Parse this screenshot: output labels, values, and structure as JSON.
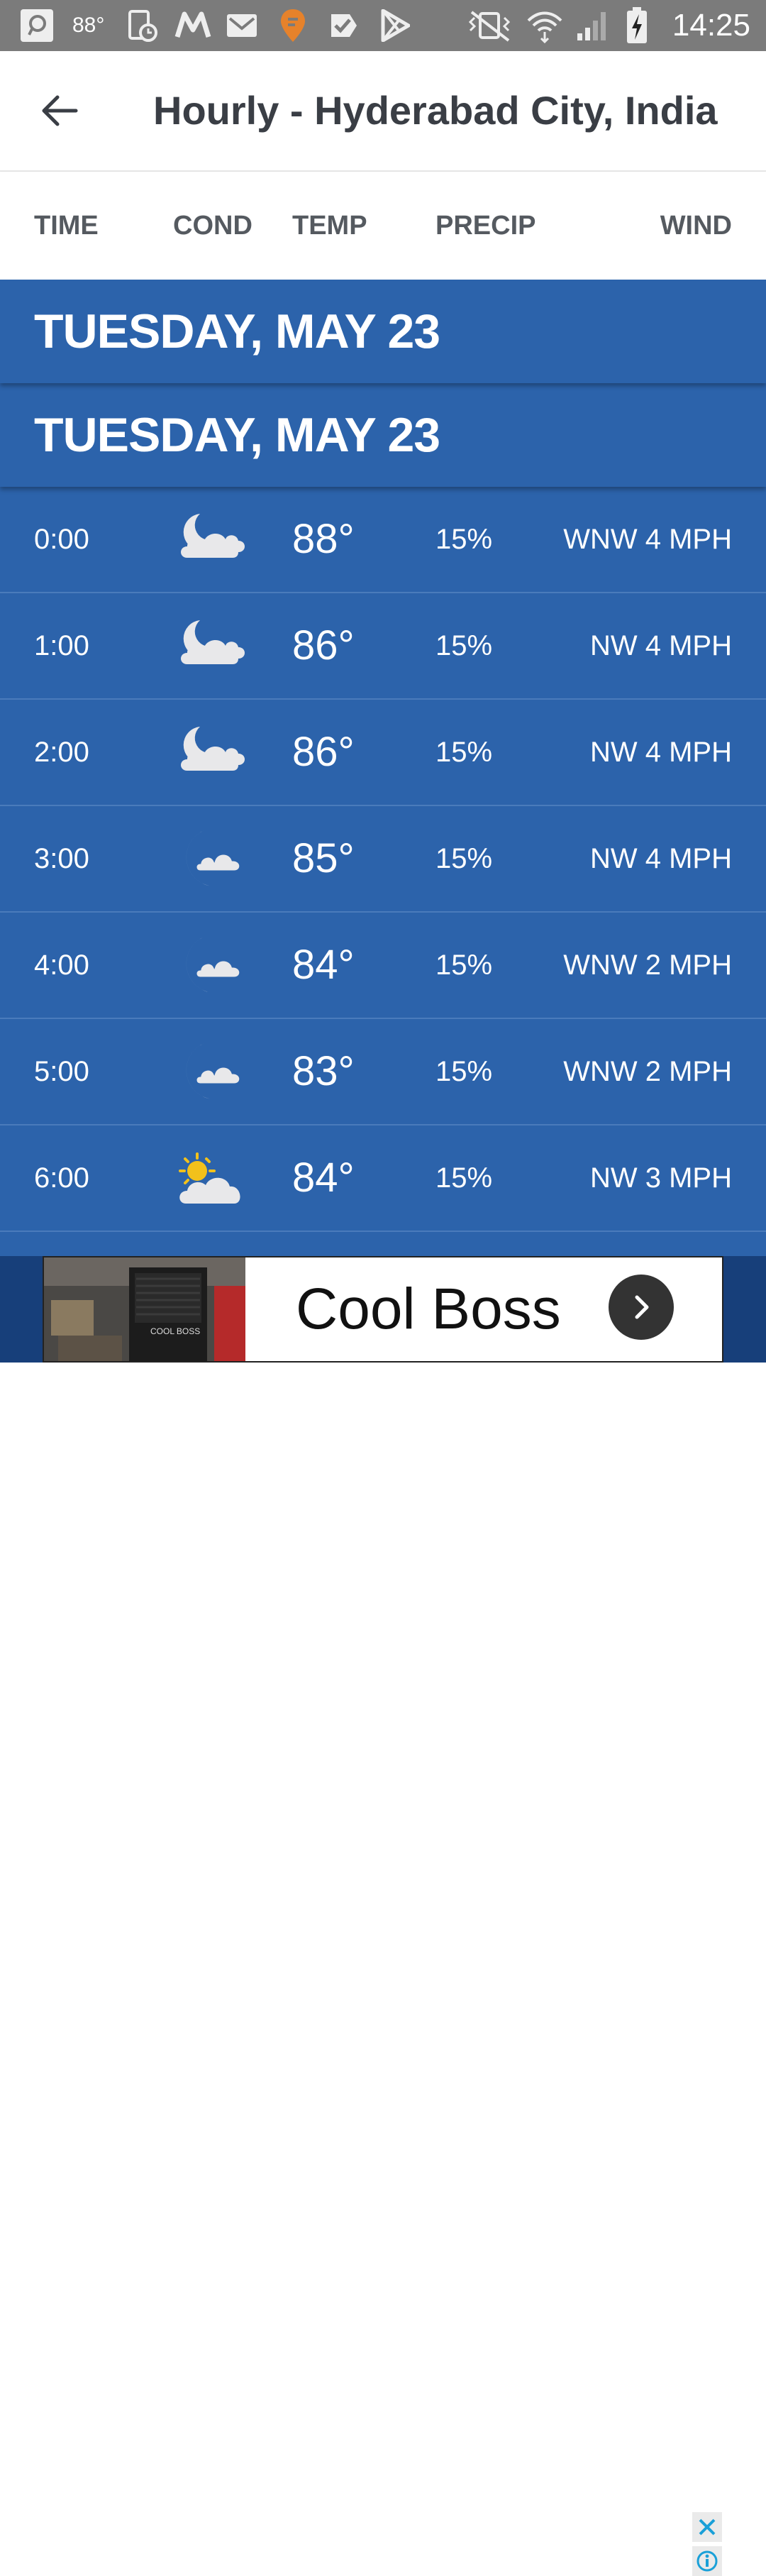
{
  "status_bar": {
    "temp": "88°",
    "time": "14:25",
    "icons": [
      "message-icon",
      "screen-time-icon",
      "myntra-icon",
      "gmail-icon",
      "swiggy-icon",
      "tasks-icon",
      "play-store-icon",
      "vibrate-icon",
      "wifi-icon",
      "signal-icon",
      "battery-charging-icon"
    ]
  },
  "app_bar": {
    "title": "Hourly - Hyderabad City, India",
    "back_icon": "arrow-left-icon"
  },
  "columns": {
    "time": "TIME",
    "cond": "COND",
    "temp": "TEMP",
    "precip": "PRECIP",
    "wind": "WIND"
  },
  "day_headers": [
    "TUESDAY, MAY 23",
    "TUESDAY, MAY 23"
  ],
  "rows": [
    {
      "time": "0:00",
      "cond": "partly-cloudy-night-icon",
      "temp": "88°",
      "precip": "15%",
      "wind": "WNW 4 MPH"
    },
    {
      "time": "1:00",
      "cond": "partly-cloudy-night-icon",
      "temp": "86°",
      "precip": "15%",
      "wind": "NW 4 MPH"
    },
    {
      "time": "2:00",
      "cond": "partly-cloudy-night-icon",
      "temp": "86°",
      "precip": "15%",
      "wind": "NW 4 MPH"
    },
    {
      "time": "3:00",
      "cond": "mostly-clear-night-icon",
      "temp": "85°",
      "precip": "15%",
      "wind": "NW 4 MPH"
    },
    {
      "time": "4:00",
      "cond": "mostly-clear-night-icon",
      "temp": "84°",
      "precip": "15%",
      "wind": "WNW 2 MPH"
    },
    {
      "time": "5:00",
      "cond": "mostly-clear-night-icon",
      "temp": "83°",
      "precip": "15%",
      "wind": "WNW 2 MPH"
    },
    {
      "time": "6:00",
      "cond": "partly-sunny-icon",
      "temp": "84°",
      "precip": "15%",
      "wind": "NW 3 MPH"
    }
  ],
  "ad": {
    "text": "Cool Boss",
    "photo_label": "COOL BOSS"
  },
  "colors": {
    "list_bg": "#2c63ab",
    "status_bar": "#7b7b7b",
    "title_text": "#3a3e45"
  }
}
